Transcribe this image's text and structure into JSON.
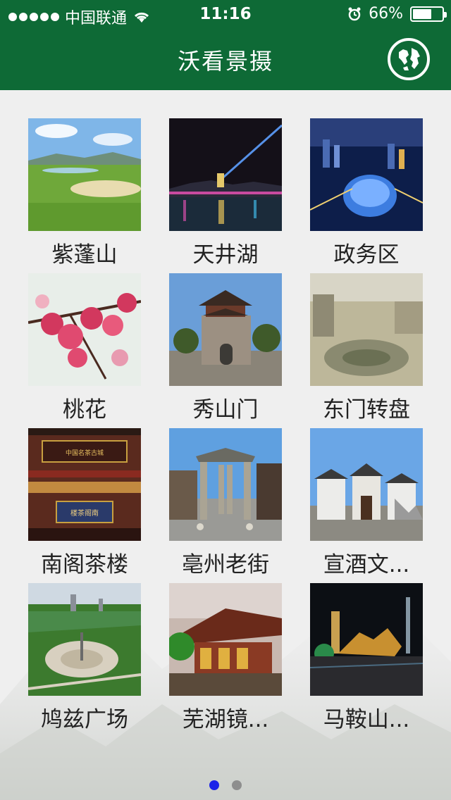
{
  "status": {
    "carrier": "中国联通",
    "time": "11:16",
    "battery_text": "66%",
    "battery_level": 0.66
  },
  "header": {
    "title": "沃看景摄",
    "bg_color": "#0e6a36"
  },
  "tiles": [
    {
      "label": "紫蓬山"
    },
    {
      "label": "天井湖"
    },
    {
      "label": "政务区"
    },
    {
      "label": "桃花"
    },
    {
      "label": "秀山门"
    },
    {
      "label": "东门转盘"
    },
    {
      "label": "南阁茶楼",
      "sign_top": "中国名茶古城",
      "sign_bottom": "楼茶阁南"
    },
    {
      "label": "亳州老街"
    },
    {
      "label": "宣酒文..."
    },
    {
      "label": "鸠兹广场"
    },
    {
      "label": "芜湖镜..."
    },
    {
      "label": "马鞍山..."
    }
  ],
  "pager": {
    "pages": 2,
    "current": 1,
    "active_color": "#1a22e8"
  }
}
